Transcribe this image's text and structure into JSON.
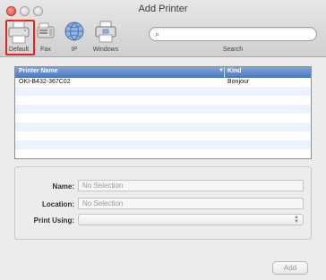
{
  "window": {
    "title": "Add Printer"
  },
  "toolbar": {
    "tools": [
      {
        "label": "Default",
        "icon": "printer-icon",
        "selected": true
      },
      {
        "label": "Fax",
        "icon": "fax-icon"
      },
      {
        "label": "IP",
        "icon": "globe-icon"
      },
      {
        "label": "Windows",
        "icon": "windows-printer-icon"
      }
    ],
    "search": {
      "placeholder": "",
      "caption": "Search"
    }
  },
  "printer_list": {
    "columns": {
      "name": "Printer Name",
      "kind": "Kind"
    },
    "rows": [
      {
        "name": "OKI-B432-367C02",
        "kind": "Bonjour"
      }
    ]
  },
  "details": {
    "name_label": "Name:",
    "name_value": "No Selection",
    "location_label": "Location:",
    "location_value": "No Selection",
    "print_using_label": "Print Using:",
    "print_using_value": ""
  },
  "actions": {
    "add_label": "Add"
  },
  "colors": {
    "selection_outline": "#e02424",
    "header_blue": "#5a86cf"
  }
}
